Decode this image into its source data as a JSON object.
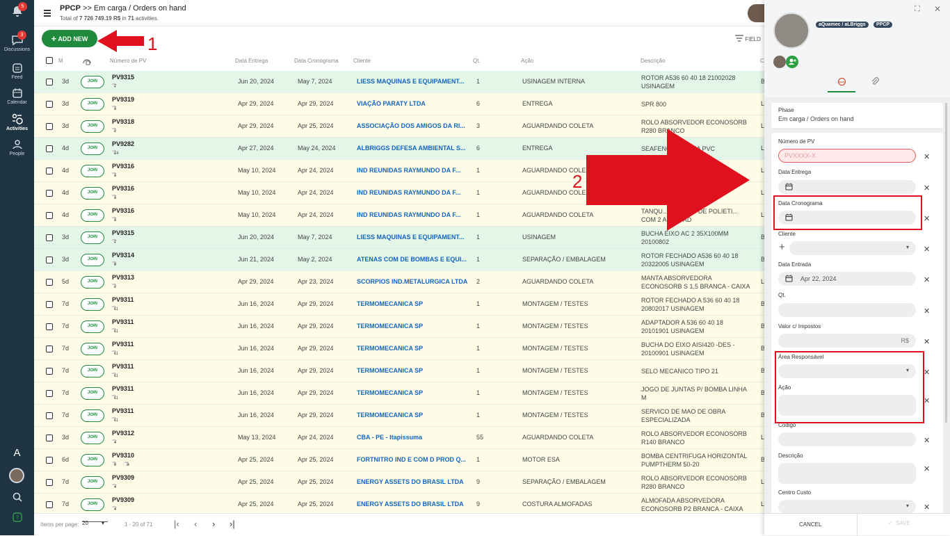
{
  "sidebar": {
    "notifications_badge": "5",
    "items": [
      {
        "label": "Discussions",
        "badge": "3"
      },
      {
        "label": "Feed"
      },
      {
        "label": "Calendar"
      },
      {
        "label": "Activities"
      },
      {
        "label": "People"
      }
    ]
  },
  "header": {
    "app": "PPCP",
    "breadcrumb": ">> Em carga / Orders on hand",
    "total_prefix": "Total of",
    "total_value": "7 726 749.19 R$",
    "total_mid": "in",
    "total_count": "71",
    "total_suffix": "activities."
  },
  "toolbar": {
    "add_new": "ADD NEW",
    "fields": "FIELD"
  },
  "columns": {
    "m": "M",
    "pv": "Número de PV",
    "data_entrega": "Data Entrega",
    "data_crono": "Data Cronograma",
    "cliente": "Cliente",
    "qt": "Qt.",
    "acao": "Ação",
    "descricao": "Descrição",
    "c": "C"
  },
  "join_label": "JOIN",
  "rows": [
    {
      "m": "3d",
      "pv": "PV9315",
      "c1": "7",
      "entrega": "Jun 20, 2024",
      "crono": "May 7, 2024",
      "cliente": "LIESS MAQUINAS E EQUIPAMENT...",
      "qt": "1",
      "acao": "USINAGEM INTERNA",
      "desc": "ROTOR A536 60 40 18 21002028 USINAGEM",
      "c": "B"
    },
    {
      "m": "3d",
      "pv": "PV9319",
      "c1": "3",
      "entrega": "Apr 29, 2024",
      "crono": "Apr 29, 2024",
      "cliente": "VIAÇÃO PARATY LTDA",
      "qt": "6",
      "acao": "ENTREGA",
      "desc": "SPR 800",
      "c": "L"
    },
    {
      "m": "3d",
      "pv": "PV9318",
      "c1": "2",
      "entrega": "Apr 29, 2024",
      "crono": "Apr 25, 2024",
      "cliente": "ASSOCIAÇÃO DOS AMIGOS DA RI...",
      "qt": "3",
      "acao": "AGUARDANDO COLETA",
      "desc": "ROLO ABSORVEDOR ECONOSORB R280 BRANCO",
      "c": "L"
    },
    {
      "m": "4d",
      "pv": "PV9282",
      "c1": "24",
      "entrega": "Apr 27, 2024",
      "crono": "May 24, 2024",
      "cliente": "ALBRIGGS DEFESA AMBIENTAL S...",
      "qt": "6",
      "acao": "ENTREGA",
      "desc": "SEAFENCE ... LONA PVC",
      "c": "L"
    },
    {
      "m": "4d",
      "pv": "PV9316",
      "c1": "3",
      "entrega": "May 10, 2024",
      "crono": "Apr 24, 2024",
      "cliente": "IND REUNIDAS RAYMUNDO DA F...",
      "qt": "1",
      "acao": "AGUARDANDO COLE...",
      "desc": "",
      "c": "L"
    },
    {
      "m": "4d",
      "pv": "PV9316",
      "c1": "3",
      "entrega": "May 10, 2024",
      "crono": "Apr 24, 2024",
      "cliente": "IND REUNIDAS RAYMUNDO DA F...",
      "qt": "1",
      "acao": "AGUARDANDO COLE...",
      "desc": "",
      "c": "L"
    },
    {
      "m": "4d",
      "pv": "PV9316",
      "c1": "3",
      "entrega": "May 10, 2024",
      "crono": "Apr 24, 2024",
      "cliente": "IND REUNIDAS RAYMUNDO DA F...",
      "qt": "1",
      "acao": "AGUARDANDO COLETA",
      "desc": "TANQU... BRANCO DE POLIETI... COM 2 ADAPTAD",
      "c": "L"
    },
    {
      "m": "3d",
      "pv": "PV9315",
      "c1": "7",
      "entrega": "Jun 20, 2024",
      "crono": "May 7, 2024",
      "cliente": "LIESS MAQUINAS E EQUIPAMENT...",
      "qt": "1",
      "acao": "USINAGEM",
      "desc": "BUCHA EIXO AC 2 35X100MM 20100802",
      "c": "B"
    },
    {
      "m": "3d",
      "pv": "PV9314",
      "c1": "9",
      "entrega": "Jun 21, 2024",
      "crono": "May 2, 2024",
      "cliente": "ATENAS COM DE BOMBAS E EQUI...",
      "qt": "1",
      "acao": "SEPARAÇÃO / EMBALAGEM",
      "desc": "ROTOR FECHADO A536 60 40 18 20322005 USINAGEM",
      "c": "B"
    },
    {
      "m": "5d",
      "pv": "PV9313",
      "c1": "2",
      "entrega": "Apr 29, 2024",
      "crono": "Apr 23, 2024",
      "cliente": "SCORPIOS IND.METALURGICA LTDA",
      "qt": "2",
      "acao": "AGUARDANDO COLETA",
      "desc": "MANTA ABSORVEDORA ECONOSORB S 1,5 BRANCA - CAIXA",
      "c": "L"
    },
    {
      "m": "7d",
      "pv": "PV9311",
      "c1": "11",
      "entrega": "Jun 16, 2024",
      "crono": "Apr 29, 2024",
      "cliente": "TERMOMECANICA SP",
      "qt": "1",
      "acao": "MONTAGEM / TESTES",
      "desc": "ROTOR FECHADO A 536 60 40 18 20802017 USINAGEM",
      "c": "B"
    },
    {
      "m": "7d",
      "pv": "PV9311",
      "c1": "11",
      "entrega": "Jun 16, 2024",
      "crono": "Apr 29, 2024",
      "cliente": "TERMOMECANICA SP",
      "qt": "1",
      "acao": "MONTAGEM / TESTES",
      "desc": "ADAPTADOR A 536 60 40 18 20101901 USINAGEM",
      "c": "B"
    },
    {
      "m": "7d",
      "pv": "PV9311",
      "c1": "11",
      "entrega": "Jun 16, 2024",
      "crono": "Apr 29, 2024",
      "cliente": "TERMOMECANICA SP",
      "qt": "1",
      "acao": "MONTAGEM / TESTES",
      "desc": "BUCHA DO EIXO AISI420 -DES - 20100901 USINAGEM",
      "c": "B"
    },
    {
      "m": "7d",
      "pv": "PV9311",
      "c1": "11",
      "entrega": "Jun 16, 2024",
      "crono": "Apr 29, 2024",
      "cliente": "TERMOMECANICA SP",
      "qt": "1",
      "acao": "MONTAGEM / TESTES",
      "desc": "SELO MECANICO TIPO 21",
      "c": "B"
    },
    {
      "m": "7d",
      "pv": "PV9311",
      "c1": "11",
      "entrega": "Jun 16, 2024",
      "crono": "Apr 29, 2024",
      "cliente": "TERMOMECANICA SP",
      "qt": "1",
      "acao": "MONTAGEM / TESTES",
      "desc": "JOGO DE JUNTAS P/ BOMBA LINHA M",
      "c": "B"
    },
    {
      "m": "7d",
      "pv": "PV9311",
      "c1": "11",
      "entrega": "Jun 16, 2024",
      "crono": "Apr 29, 2024",
      "cliente": "TERMOMECANICA SP",
      "qt": "1",
      "acao": "MONTAGEM / TESTES",
      "desc": "SERVICO DE MAO DE OBRA ESPECIALIZADA",
      "c": "B"
    },
    {
      "m": "3d",
      "pv": "PV9312",
      "c1": "4",
      "entrega": "May 13, 2024",
      "crono": "Apr 24, 2024",
      "cliente": "CBA - PE - Itapissuma",
      "qt": "55",
      "acao": "AGUARDANDO COLETA",
      "desc": "ROLO ABSORVEDOR ECONOSORB R140 BRANCO",
      "c": "L"
    },
    {
      "m": "6d",
      "pv": "PV9310",
      "c1": "9",
      "c2": "3",
      "entrega": "Apr 25, 2024",
      "crono": "Apr 25, 2024",
      "cliente": "FORTNITRO IND E COM D PROD Q...",
      "qt": "1",
      "acao": "MOTOR ESA",
      "desc": "BOMBA CENTRIFUGA HORIZONTAL PUMPTHERM 50-20",
      "c": "B"
    },
    {
      "m": "7d",
      "pv": "PV9309",
      "c1": "4",
      "entrega": "Apr 25, 2024",
      "crono": "Apr 25, 2024",
      "cliente": "ENERGY ASSETS DO BRASIL LTDA",
      "qt": "9",
      "acao": "SEPARAÇÃO / EMBALAGEM",
      "desc": "ROLO ABSORVEDOR ECONOSORB R280 BRANCO",
      "c": "L"
    },
    {
      "m": "7d",
      "pv": "PV9309",
      "c1": "4",
      "entrega": "Apr 25, 2024",
      "crono": "Apr 25, 2024",
      "cliente": "ENERGY ASSETS DO BRASIL LTDA",
      "qt": "9",
      "acao": "COSTURA ALMOFADAS",
      "desc": "ALMOFADA ABSORVEDORA ECONOSORB P2 BRANCA - CAIXA",
      "c": "L"
    }
  ],
  "footer": {
    "items_per_page_label": "Items per page:",
    "items_per_page": "20",
    "range": "1 - 20 of 71"
  },
  "panel": {
    "tag1": "aQuamec / aLBriggs",
    "tag2": "PPCP",
    "phase_label": "Phase",
    "phase_value": "Em carga / Orders on hand",
    "fields": {
      "numero_pv": {
        "label": "Número de PV",
        "placeholder": "PVXXXX-X"
      },
      "data_entrega": {
        "label": "Data Entrega"
      },
      "data_crono": {
        "label": "Data Cronograma"
      },
      "cliente": {
        "label": "Cliente"
      },
      "data_entrada": {
        "label": "Data Entrada",
        "value": "Apr 22, 2024"
      },
      "qt": {
        "label": "Qt."
      },
      "valor": {
        "label": "Valor c/ Impostos",
        "suffix": "R$"
      },
      "area": {
        "label": "Área Responsável"
      },
      "acao": {
        "label": "Ação"
      },
      "codigo": {
        "label": "Código"
      },
      "descricao": {
        "label": "Descrição"
      },
      "centro": {
        "label": "Centro Custo"
      }
    },
    "cancel": "CANCEL",
    "save": "SAVE"
  },
  "annotations": {
    "label1": "1",
    "label2": "2"
  },
  "colors": {
    "accent": "#1e8a3c",
    "annotation": "#e0101e",
    "sidebar": "#1f3442",
    "link": "#1565c0"
  }
}
